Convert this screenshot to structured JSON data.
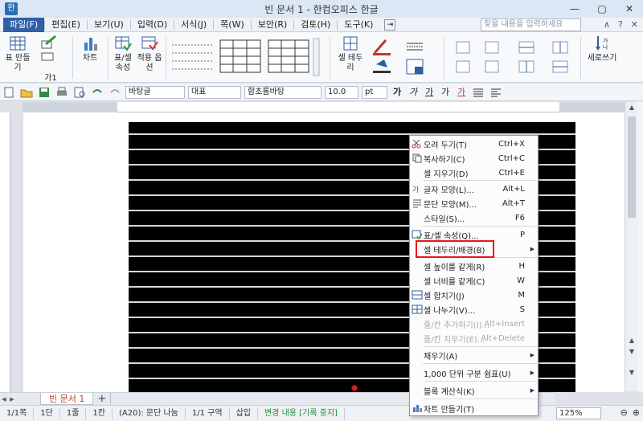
{
  "window": {
    "title": "빈 문서 1 - 한컴오피스 한글",
    "minimize": "—",
    "restore": "▢",
    "close": "✕"
  },
  "menu": {
    "items": [
      "파일(F)",
      "편집(E)",
      "보기(U)",
      "입력(D)",
      "서식(J)",
      "쪽(W)",
      "보안(R)",
      "검토(H)",
      "도구(K)"
    ],
    "search_placeholder": "찾을 내용을 입력하세요",
    "right": [
      "∧",
      "?",
      "✕"
    ]
  },
  "ribbon": {
    "make_table": "표 만들기",
    "chart": "차트",
    "table_cell_props": "표/셀 속성",
    "apply_options": "적용 옵션",
    "cell_border": "셀 테두리",
    "vertical_writing": "세로쓰기",
    "small_label": "가1"
  },
  "toolbar": {
    "style": "바탕글",
    "lang": "대표",
    "font": "함초롬바탕",
    "size": "10.0",
    "unit": "pt",
    "fmt": [
      "가",
      "가",
      "가",
      "가",
      "가"
    ]
  },
  "tabs": {
    "sheet": "빈 문서 1",
    "add": "+"
  },
  "status": {
    "page": "1/1쪽",
    "column": "1단",
    "line": "1줄",
    "col": "1칸",
    "cell": "(A20): 문단 나눔",
    "section": "1/1 구역",
    "mode": "삽입",
    "track": "변경 내용 [기록 중지]",
    "zoom": "125%"
  },
  "context_menu": {
    "items": [
      {
        "label": "오려 두기(T)",
        "shortcut": "Ctrl+X",
        "icon": "scissors-icon",
        "enabled": true
      },
      {
        "label": "복사하기(C)",
        "shortcut": "Ctrl+C",
        "icon": "copy-icon",
        "enabled": true
      },
      {
        "label": "셀 지우기(D)",
        "shortcut": "Ctrl+E",
        "icon": "",
        "enabled": true
      },
      {
        "label": "글자 모양(L)...",
        "shortcut": "Alt+L",
        "icon": "char-shape-icon",
        "enabled": true
      },
      {
        "label": "문단 모양(M)...",
        "shortcut": "Alt+T",
        "icon": "para-shape-icon",
        "enabled": true
      },
      {
        "label": "스타일(S)...",
        "shortcut": "F6",
        "icon": "",
        "enabled": true
      },
      {
        "label": "표/셀 속성(Q)...",
        "shortcut": "P",
        "icon": "table-props-icon",
        "enabled": true
      },
      {
        "label": "셀 테두리/배경(B)",
        "shortcut": "",
        "icon": "",
        "enabled": true,
        "submenu": true
      },
      {
        "label": "셀 높이를 같게(R)",
        "shortcut": "H",
        "icon": "",
        "enabled": true
      },
      {
        "label": "셀 너비를 같게(C)",
        "shortcut": "W",
        "icon": "",
        "enabled": true
      },
      {
        "label": "셀 합치기(J)",
        "shortcut": "M",
        "icon": "merge-cells-icon",
        "enabled": true
      },
      {
        "label": "셀 나누기(V)...",
        "shortcut": "S",
        "icon": "split-cells-icon",
        "enabled": true
      },
      {
        "label": "줄/칸 추가하기(I)...",
        "shortcut": "Alt+Insert",
        "icon": "",
        "enabled": false
      },
      {
        "label": "줄/칸 지우기(E)...",
        "shortcut": "Alt+Delete",
        "icon": "",
        "enabled": false
      },
      {
        "label": "채우기(A)",
        "shortcut": "",
        "icon": "",
        "enabled": true,
        "submenu": true
      },
      {
        "label": "1,000 단위 구분 쉼표(U)",
        "shortcut": "",
        "icon": "",
        "enabled": true,
        "submenu": true
      },
      {
        "label": "블록 계산식(K)",
        "shortcut": "",
        "icon": "",
        "enabled": true,
        "submenu": true
      },
      {
        "label": "차트 만들기(T)",
        "shortcut": "",
        "icon": "chart-icon",
        "enabled": true
      }
    ]
  },
  "colors": {
    "accent": "#2f5fa7",
    "highlight_border": "#e8141c",
    "status_green": "#1f8a3a"
  }
}
